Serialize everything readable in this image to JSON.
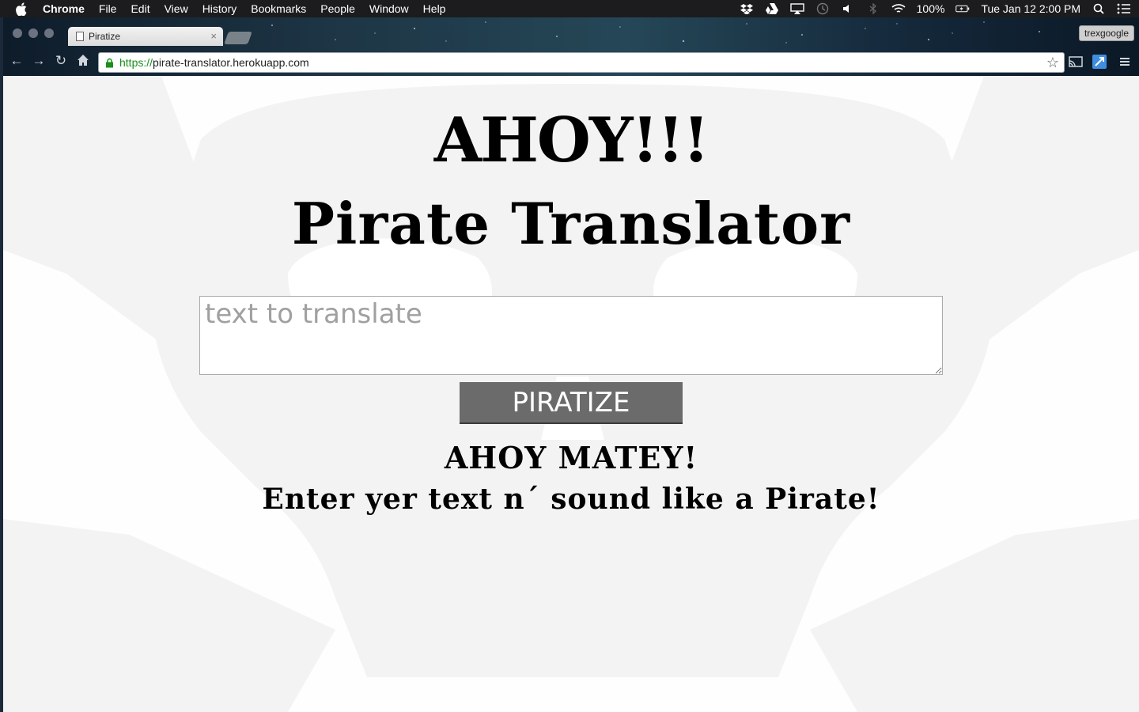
{
  "menubar": {
    "app_name": "Chrome",
    "items": [
      "File",
      "Edit",
      "View",
      "History",
      "Bookmarks",
      "People",
      "Window",
      "Help"
    ],
    "battery": "100%",
    "clock": "Tue Jan 12  2:00 PM"
  },
  "browser": {
    "tab_title": "Piratize",
    "profile_name": "trexgoogle",
    "url_scheme": "https://",
    "url_host": "pirate-translator.herokuapp.com"
  },
  "page": {
    "heading": "AHOY!!!",
    "subheading": "Pirate Translator",
    "input_placeholder": "text to translate",
    "button_label": "PIRATIZE",
    "output_line1": "AHOY MATEY!",
    "output_line2": "Enter yer text n´ sound like a Pirate!"
  },
  "colors": {
    "button_bg": "#6b6b6b",
    "url_scheme": "#1a8f1a",
    "page_bg": "#fefefe"
  }
}
